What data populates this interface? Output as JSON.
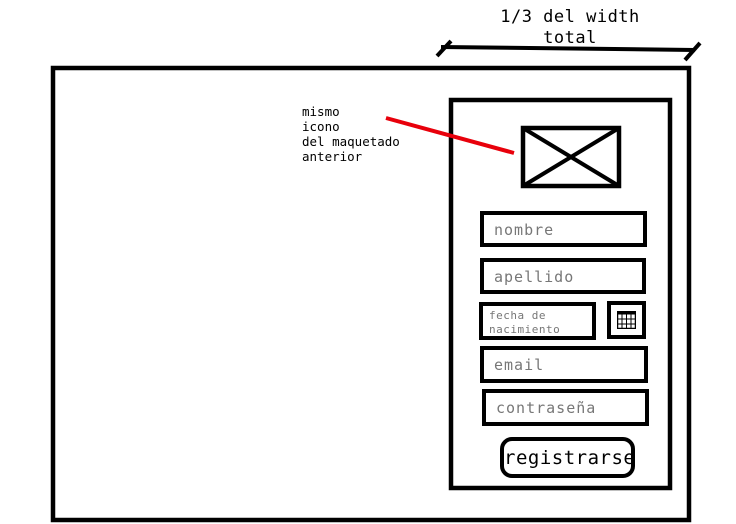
{
  "annotations": {
    "width_note": "1/3 del width\ntotal",
    "icon_note": "mismo\nicono\ndel maquetado\nanterior"
  },
  "form": {
    "nombre_placeholder": "nombre",
    "apellido_placeholder": "apellido",
    "fecha_placeholder": "fecha de\nnacimiento",
    "email_placeholder": "email",
    "password_placeholder": "contraseña",
    "submit_label": "registrarse"
  },
  "colors": {
    "stroke": "#000000",
    "annotation_line": "#e8000b",
    "placeholder": "#777777"
  }
}
